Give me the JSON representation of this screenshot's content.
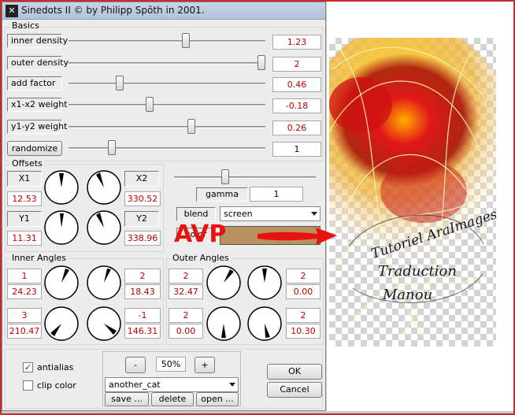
{
  "window": {
    "title": "Sinedots II © by Philipp Spöth in 2001."
  },
  "basics": {
    "label": "Basics",
    "rows": [
      {
        "label": "inner density",
        "value": "1.23",
        "level": 0.6
      },
      {
        "label": "outer density",
        "value": "2",
        "level": 1.0
      },
      {
        "label": "add factor",
        "value": "0.46",
        "level": 0.25
      },
      {
        "label": "x1-x2 weight",
        "value": "-0.18",
        "level": 0.41
      },
      {
        "label": "y1-y2 weight",
        "value": "0.26",
        "level": 0.63
      },
      {
        "label": "randomize",
        "value": "1",
        "level": 0.21
      }
    ]
  },
  "offsets": {
    "label": "Offsets",
    "x1_label": "X1",
    "x1_value": "12.53",
    "x2_label": "X2",
    "x2_value": "330.52",
    "y1_label": "Y1",
    "y1_value": "11.31",
    "y2_label": "Y2",
    "y2_value": "338.96"
  },
  "gamma": {
    "label": "gamma",
    "value": "1",
    "level": 0.35
  },
  "blend": {
    "label": "blend",
    "selected": "screen"
  },
  "color": {
    "label": "color",
    "swatch": "#b7925c"
  },
  "watermark": {
    "text": "AVP",
    "color": "#e8120f"
  },
  "inner_angles": {
    "label": "Inner Angles",
    "values": [
      {
        "top": "1",
        "bottom": "24.23"
      },
      {
        "top": "2",
        "bottom": "18.43"
      },
      {
        "top": "3",
        "bottom": "210.47"
      },
      {
        "top": "-1",
        "bottom": "146.31"
      }
    ]
  },
  "outer_angles": {
    "label": "Outer Angles",
    "values": [
      {
        "top": "2",
        "bottom": "32.47"
      },
      {
        "top": "2",
        "bottom": "0.00"
      },
      {
        "top": "2",
        "bottom": "0.00"
      },
      {
        "top": "2",
        "bottom": "10.30"
      }
    ]
  },
  "options": {
    "antialias_label": "antialias",
    "antialias_checked": true,
    "clip_color_label": "clip color",
    "clip_color_checked": false
  },
  "preview": {
    "minus_label": "-",
    "zoom": "50%",
    "plus_label": "+",
    "preset": "another_cat",
    "save_label": "save ...",
    "delete_label": "delete",
    "open_label": "open ..."
  },
  "dialog": {
    "ok_label": "OK",
    "cancel_label": "Cancel"
  },
  "preview_image": {
    "caption_lines": [
      "Tutoriel AraImages",
      "Traduction",
      "Manou"
    ]
  }
}
